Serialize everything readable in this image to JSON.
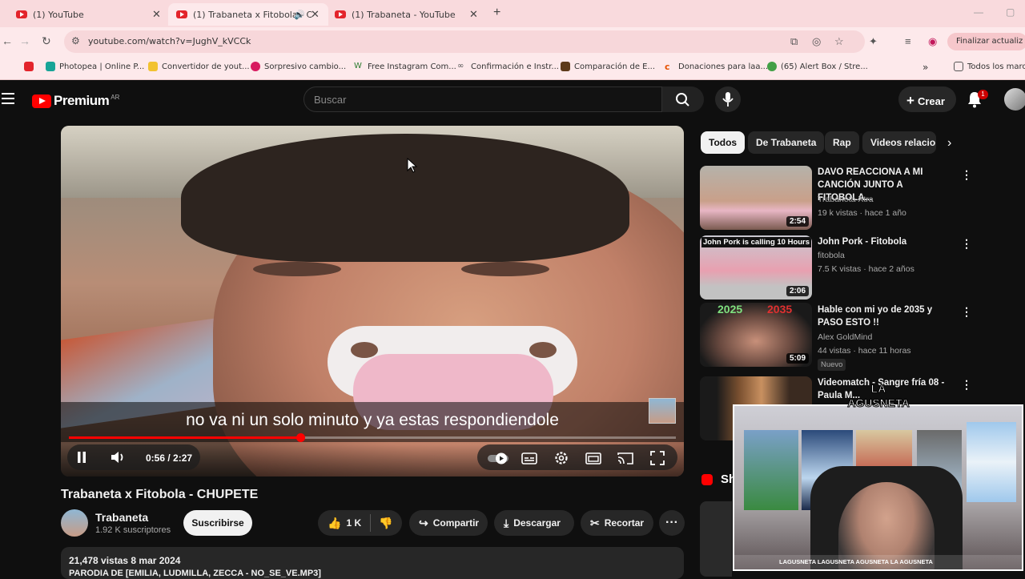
{
  "browser": {
    "tabs": [
      {
        "title": "(1) YouTube"
      },
      {
        "title": "(1) Trabaneta x Fitobola - C"
      },
      {
        "title": "(1) Trabaneta - YouTube"
      }
    ],
    "url": "youtube.com/watch?v=JughV_kVCCk",
    "update_button": "Finalizar actualiz",
    "bookmarks": [
      {
        "label": "Photopea | Online P..."
      },
      {
        "label": "Convertidor de yout..."
      },
      {
        "label": "Sorpresivo cambio..."
      },
      {
        "label": "Free Instagram Com..."
      },
      {
        "label": "Confirmación e Instr..."
      },
      {
        "label": "Comparación de E..."
      },
      {
        "label": "Donaciones para laa..."
      },
      {
        "label": "(65) Alert Box / Stre..."
      }
    ],
    "all_bookmarks": "Todos los marca"
  },
  "youtube": {
    "logo": "Premium",
    "logo_region": "AR",
    "search_placeholder": "Buscar",
    "create_label": "Crear",
    "notifications_count": "1"
  },
  "player": {
    "subtitle": "no va ni un solo minuto y ya estas respondiendole",
    "time": "0:56 / 2:27",
    "progress": 0.381
  },
  "video": {
    "title": "Trabaneta x Fitobola - CHUPETE",
    "channel": "Trabaneta",
    "subscribers": "1.92 K suscriptores",
    "subscribe_label": "Suscribirse",
    "likes": "1 K",
    "share_label": "Compartir",
    "download_label": "Descargar",
    "clip_label": "Recortar",
    "views_date": "21,478 vistas  8 mar 2024",
    "description": "PARODIA DE [EMILIA, LUDMILLA, ZECCA - NO_SE_VE.MP3]"
  },
  "sidebar": {
    "chips": [
      "Todos",
      "De Trabaneta",
      "Rap",
      "Videos relacio"
    ],
    "recommendations": [
      {
        "title": "DAVO REACCIONA A MI CANCIÓN JUNTO A FITOBOLA...",
        "channel": "Trabaneta Xtra",
        "meta": "19 k vistas · hace 1 año",
        "duration": "2:54",
        "thumb_text": "",
        "badge": ""
      },
      {
        "title": "John Pork - Fitobola",
        "channel": "fitobola",
        "meta": "7.5 K vistas · hace 2 años",
        "duration": "2:06",
        "thumb_text": "John Pork is calling 10 Hours",
        "badge": ""
      },
      {
        "title": "Hable con mi yo de 2035 y PASO ESTO !!",
        "channel": "Alex GoldMind",
        "meta": "44 vistas · hace 11 horas",
        "duration": "5:09",
        "thumb_text": "2025",
        "thumb_text2": "2035",
        "badge": "Nuevo"
      },
      {
        "title": "Videomatch - Sangre fría 08 - Paula M...",
        "channel": "",
        "meta": "",
        "duration": "",
        "thumb_text": "",
        "badge": ""
      }
    ],
    "shorts_label": "Sh"
  },
  "webcam": {
    "logo_line1": "LA",
    "logo_line2": "AGUSNETA",
    "socials": "LAGUSNETA   LAGUSNETA   AGUSNETA   LA AGUSNETA"
  },
  "colors": {
    "yt_red": "#ff0000",
    "bg": "#0f0f0f",
    "chip": "#272727",
    "browser_tab": "#f9dadd"
  }
}
